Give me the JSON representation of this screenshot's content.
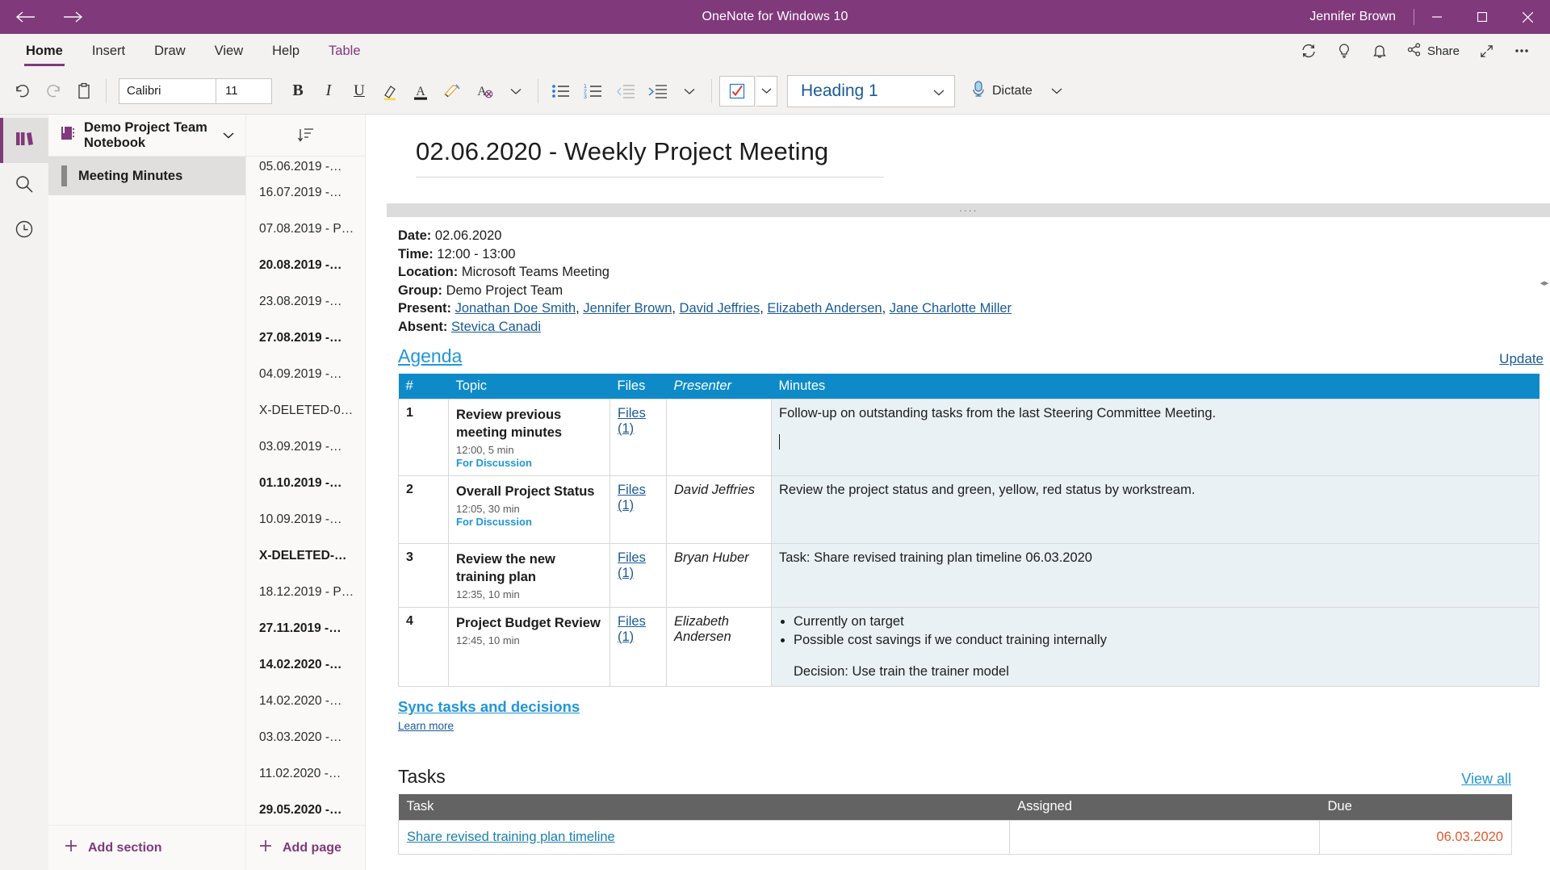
{
  "titlebar": {
    "app_title": "OneNote for Windows 10",
    "user": "Jennifer Brown",
    "back_icon": "back-arrow-icon",
    "forward_icon": "forward-arrow-icon",
    "minimize_label": "─",
    "maximize_label": "❐",
    "close_label": "✕",
    "accent_color": "#80397B"
  },
  "ribbon_tabs": [
    {
      "label": "Home",
      "active": true,
      "contextual": false
    },
    {
      "label": "Insert",
      "active": false,
      "contextual": false
    },
    {
      "label": "Draw",
      "active": false,
      "contextual": false
    },
    {
      "label": "View",
      "active": false,
      "contextual": false
    },
    {
      "label": "Help",
      "active": false,
      "contextual": false
    },
    {
      "label": "Table",
      "active": false,
      "contextual": true
    }
  ],
  "tabstrip_right": {
    "sync_icon": "sync-icon",
    "idea_icon": "lightbulb-icon",
    "notification_icon": "bell-icon",
    "share_label": "Share",
    "share_icon": "share-icon",
    "expand_icon": "expand-icon",
    "more_icon": "ellipsis-icon"
  },
  "ribbon": {
    "undo_icon": "undo-icon",
    "redo_icon": "redo-icon",
    "clipboard_icon": "clipboard-icon",
    "font_name": "Calibri",
    "font_size": "11",
    "bold_label": "B",
    "italic_label": "I",
    "underline_label": "U",
    "highlight_icon": "highlighter-icon",
    "font_color_icon": "font-color-icon",
    "format_painter_icon": "format-painter-icon",
    "clear_format_icon": "clear-formatting-icon",
    "font_more_icon": "chevron-down-icon",
    "bullets_icon": "bulleted-list-icon",
    "numbering_icon": "numbered-list-icon",
    "decrease_indent_icon": "decrease-indent-icon",
    "increase_indent_icon": "increase-indent-icon",
    "para_more_icon": "chevron-down-icon",
    "todo_icon": "checkbox-tag-icon",
    "todo_more_icon": "chevron-down-icon",
    "style_value": "Heading 1",
    "style_chevron_icon": "chevron-down-icon",
    "dictate_label": "Dictate",
    "dictate_icon": "microphone-icon",
    "dictate_chevron_icon": "chevron-down-icon"
  },
  "rail": [
    {
      "name": "notebooks",
      "icon": "notebooks-icon",
      "active": true
    },
    {
      "name": "search",
      "icon": "search-icon",
      "active": false
    },
    {
      "name": "recent",
      "icon": "clock-icon",
      "active": false
    }
  ],
  "sections": {
    "notebook_name": "Demo Project Team Notebook",
    "notebook_icon": "notebook-icon",
    "notebook_chevron_icon": "chevron-down-icon",
    "items": [
      {
        "label": "Meeting Minutes",
        "active": true
      }
    ],
    "add_section_label": "Add section",
    "add_icon": "plus-icon"
  },
  "pages": {
    "sort_icon": "sort-icon",
    "items": [
      {
        "label": "05.06.2019 -…",
        "bold": false,
        "clipped": true
      },
      {
        "label": "16.07.2019 -…",
        "bold": false
      },
      {
        "label": "07.08.2019 - P…",
        "bold": false
      },
      {
        "label": "20.08.2019 -…",
        "bold": true
      },
      {
        "label": "23.08.2019 -…",
        "bold": false
      },
      {
        "label": "27.08.2019 -…",
        "bold": true
      },
      {
        "label": "04.09.2019 -…",
        "bold": false
      },
      {
        "label": "X-DELETED-0…",
        "bold": false
      },
      {
        "label": "03.09.2019 -…",
        "bold": false
      },
      {
        "label": "01.10.2019 -…",
        "bold": true
      },
      {
        "label": "10.09.2019 -…",
        "bold": false
      },
      {
        "label": "X-DELETED-…",
        "bold": true
      },
      {
        "label": "18.12.2019 - P…",
        "bold": false
      },
      {
        "label": "27.11.2019 -…",
        "bold": true
      },
      {
        "label": "14.02.2020 -…",
        "bold": true
      },
      {
        "label": "14.02.2020 -…",
        "bold": false
      },
      {
        "label": "03.03.2020 -…",
        "bold": false
      },
      {
        "label": "11.02.2020 -…",
        "bold": false
      },
      {
        "label": "29.05.2020 -…",
        "bold": true
      }
    ],
    "add_page_label": "Add page",
    "add_icon": "plus-icon"
  },
  "page": {
    "title": "02.06.2020 - Weekly Project Meeting",
    "meta": {
      "date_label": "Date:",
      "date_value": "02.06.2020",
      "time_label": "Time:",
      "time_value": "12:00 - 13:00",
      "location_label": "Location:",
      "location_value": "Microsoft Teams Meeting",
      "group_label": "Group:",
      "group_value": "Demo Project Team",
      "present_label": "Present:",
      "present": [
        "Jonathan Doe Smith",
        "Jennifer Brown",
        "David Jeffries",
        "Elizabeth Andersen",
        "Jane Charlotte Miller"
      ],
      "absent_label": "Absent:",
      "absent": [
        "Stevica Canadi"
      ]
    },
    "agenda": {
      "heading": "Agenda",
      "update_label": "Update",
      "columns": [
        "#",
        "Topic",
        "Files",
        "Presenter",
        "Minutes"
      ],
      "header_color": "#0e8ac8",
      "rows": [
        {
          "num": "1",
          "topic": "Review previous meeting minutes",
          "time": "12:00, 5 min",
          "discussion": "For Discussion",
          "files": "Files (1)",
          "presenter": "",
          "minutes": "Follow-up on outstanding tasks from the last Steering Committee Meeting.",
          "bullets": [],
          "decision": "",
          "has_caret": true
        },
        {
          "num": "2",
          "topic": "Overall Project Status",
          "time": "12:05, 30 min",
          "discussion": "For Discussion",
          "files": "Files (1)",
          "presenter": "David Jeffries",
          "minutes": "Review the project status and green, yellow, red status by workstream.",
          "bullets": [],
          "decision": "",
          "has_caret": false
        },
        {
          "num": "3",
          "topic": "Review the new training plan",
          "time": "12:35, 10 min",
          "discussion": "",
          "files": "Files (1)",
          "presenter": "Bryan Huber",
          "minutes": "Task: Share revised training plan timeline 06.03.2020",
          "bullets": [],
          "decision": "",
          "has_caret": false
        },
        {
          "num": "4",
          "topic": "Project Budget Review",
          "time": "12:45, 10 min",
          "discussion": "",
          "files": "Files (1)",
          "presenter": "Elizabeth Andersen",
          "minutes": "",
          "bullets": [
            "Currently on target",
            "Possible cost savings if we conduct training internally"
          ],
          "decision": "Decision: Use train the trainer model",
          "has_caret": false
        }
      ]
    },
    "sync": {
      "link_label": "Sync tasks and decisions",
      "learn_more_label": "Learn more"
    },
    "tasks": {
      "heading": "Tasks",
      "view_all_label": "View all",
      "columns": [
        "Task",
        "Assigned",
        "Due"
      ],
      "header_color": "#636363",
      "rows": [
        {
          "task": "Share revised training plan timeline",
          "assigned": "",
          "due": "06.03.2020",
          "due_color": "#e05a2b"
        }
      ]
    }
  }
}
